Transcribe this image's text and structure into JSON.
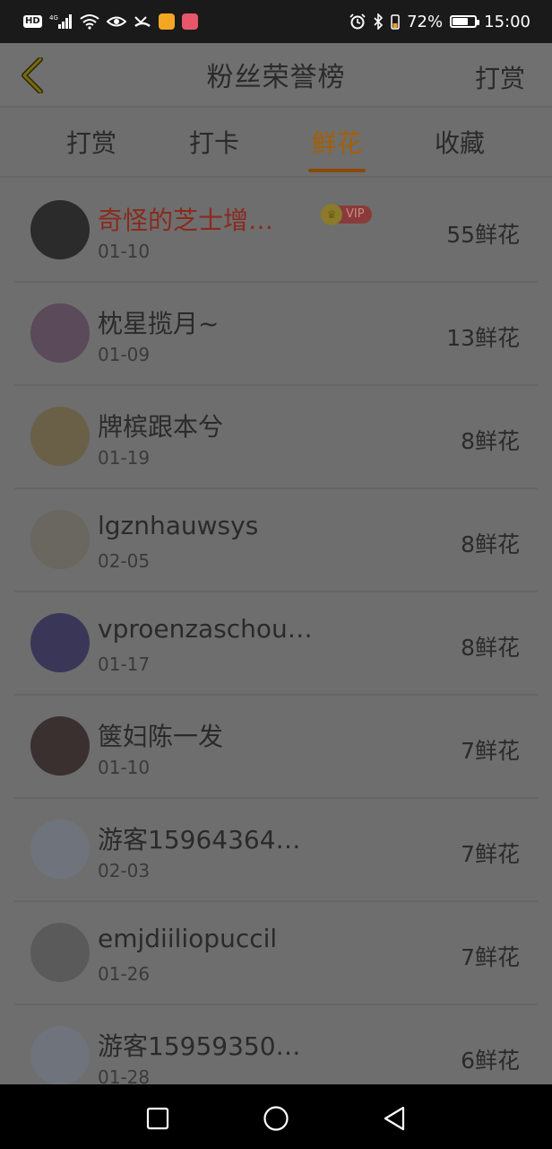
{
  "status_bar": {
    "hd": "HD",
    "network": "4G",
    "battery_percent": "72%",
    "battery_level": 0.72,
    "time": "15:00"
  },
  "header": {
    "title": "粉丝荣誉榜",
    "action_label": "打赏"
  },
  "tabs": [
    {
      "label": "打赏",
      "active": false
    },
    {
      "label": "打卡",
      "active": false
    },
    {
      "label": "鲜花",
      "active": true
    },
    {
      "label": "收藏",
      "active": false
    }
  ],
  "vip_label": "VIP",
  "fans": [
    {
      "name": "奇怪的芝士增…",
      "date": "01-10",
      "amount": "55鲜花",
      "vip": true,
      "avatar_color": "#2b2b2b"
    },
    {
      "name": "枕星揽月~",
      "date": "01-09",
      "amount": "13鲜花",
      "vip": false,
      "avatar_color": "#5a4a5a"
    },
    {
      "name": "牌槟跟本兮",
      "date": "01-19",
      "amount": "8鲜花",
      "vip": false,
      "avatar_color": "#6a6048"
    },
    {
      "name": "lgznhauwsys",
      "date": "02-05",
      "amount": "8鲜花",
      "vip": false,
      "avatar_color": "#6a6660"
    },
    {
      "name": "vproenzaschou…",
      "date": "01-17",
      "amount": "8鲜花",
      "vip": false,
      "avatar_color": "#3a3658"
    },
    {
      "name": "箧妇陈一发",
      "date": "01-10",
      "amount": "7鲜花",
      "vip": false,
      "avatar_color": "#3a3030"
    },
    {
      "name": "游客15964364…",
      "date": "02-03",
      "amount": "7鲜花",
      "vip": false,
      "avatar_color": "#6f737c"
    },
    {
      "name": "emjdiiliopuccil",
      "date": "01-26",
      "amount": "7鲜花",
      "vip": false,
      "avatar_color": "#5a5a5a"
    },
    {
      "name": "游客15959350…",
      "date": "01-28",
      "amount": "6鲜花",
      "vip": false,
      "avatar_color": "#6f737c"
    }
  ]
}
